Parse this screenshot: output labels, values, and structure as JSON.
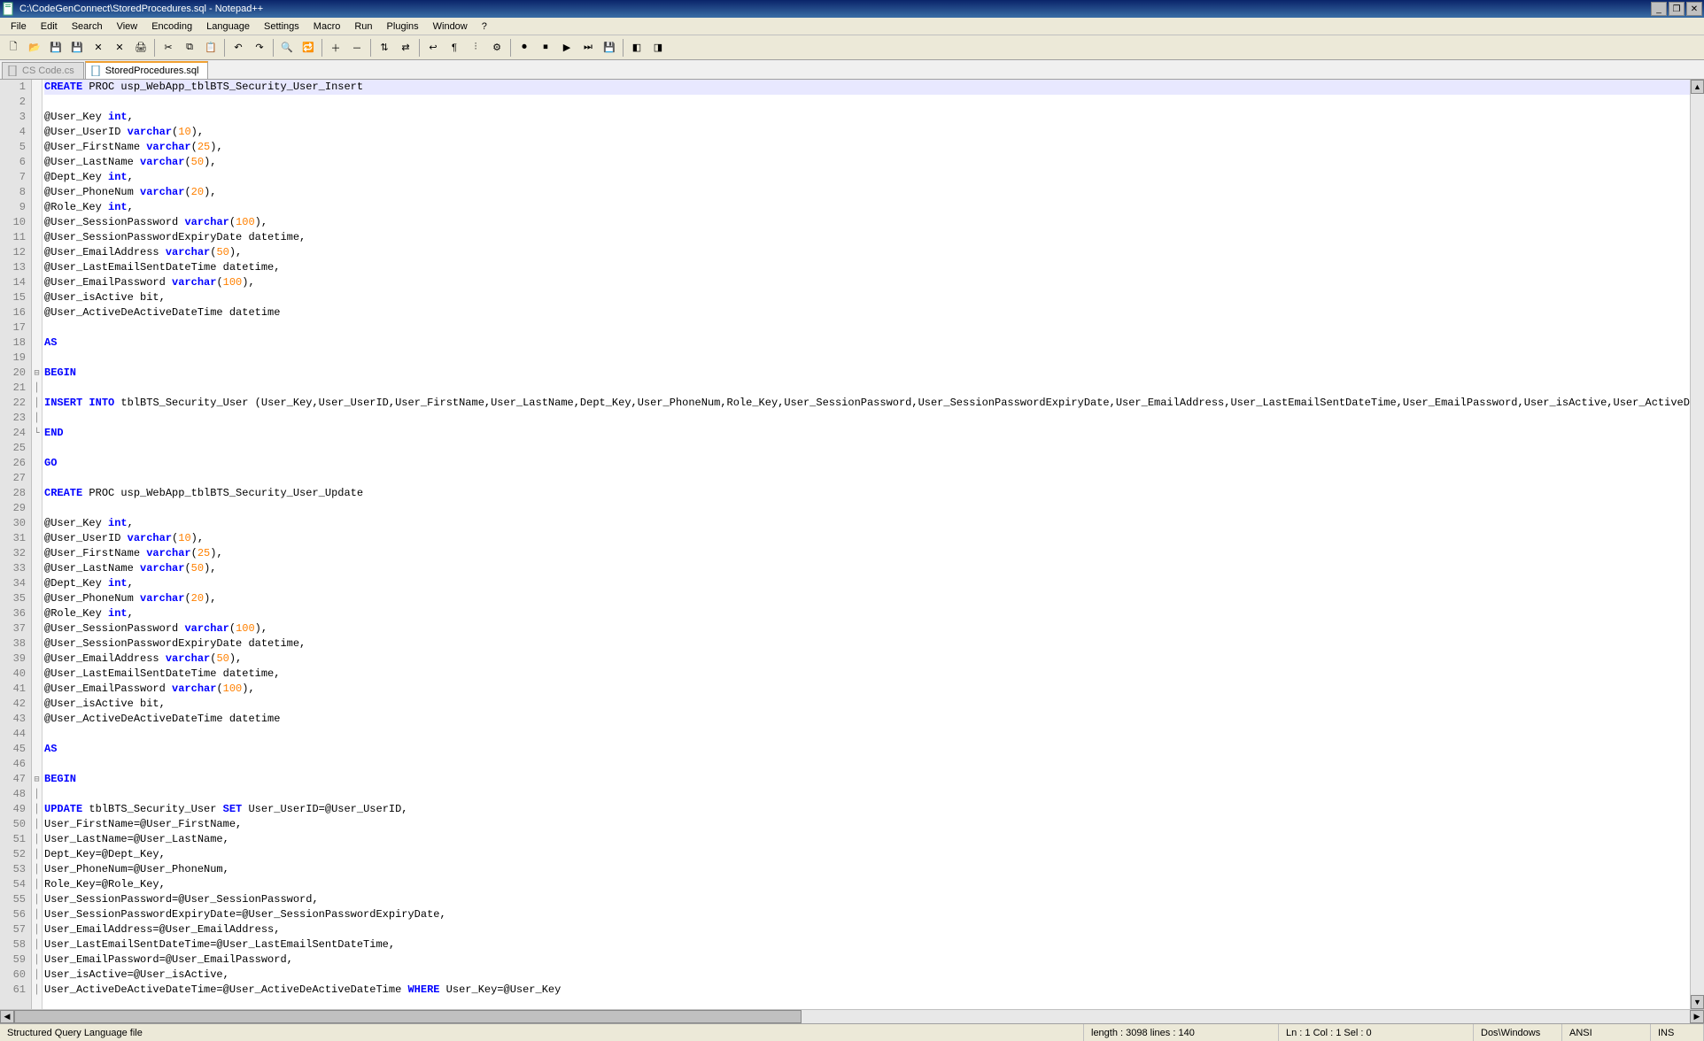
{
  "window": {
    "title": "C:\\CodeGenConnect\\StoredProcedures.sql - Notepad++"
  },
  "menu": {
    "file": "File",
    "edit": "Edit",
    "search": "Search",
    "view": "View",
    "encoding": "Encoding",
    "language": "Language",
    "settings": "Settings",
    "macro": "Macro",
    "run": "Run",
    "plugins": "Plugins",
    "window": "Window",
    "help": "?"
  },
  "tabs": {
    "inactive": "CS Code.cs",
    "active": "StoredProcedures.sql"
  },
  "status": {
    "filetype": "Structured Query Language file",
    "length": "length : 3098    lines : 140",
    "pos": "Ln : 1    Col : 1    Sel : 0",
    "eol": "Dos\\Windows",
    "enc": "ANSI",
    "ins": "INS"
  },
  "code": {
    "lines": [
      {
        "n": 1,
        "fold": "",
        "html": "<span class='kw'>CREATE</span> PROC usp_WebApp_tblBTS_Security_User_Insert",
        "current": true
      },
      {
        "n": 2,
        "fold": "",
        "html": ""
      },
      {
        "n": 3,
        "fold": "",
        "html": "@User_Key <span class='ty'>int</span>,"
      },
      {
        "n": 4,
        "fold": "",
        "html": "@User_UserID <span class='ty'>varchar</span>(<span class='num'>10</span>),"
      },
      {
        "n": 5,
        "fold": "",
        "html": "@User_FirstName <span class='ty'>varchar</span>(<span class='num'>25</span>),"
      },
      {
        "n": 6,
        "fold": "",
        "html": "@User_LastName <span class='ty'>varchar</span>(<span class='num'>50</span>),"
      },
      {
        "n": 7,
        "fold": "",
        "html": "@Dept_Key <span class='ty'>int</span>,"
      },
      {
        "n": 8,
        "fold": "",
        "html": "@User_PhoneNum <span class='ty'>varchar</span>(<span class='num'>20</span>),"
      },
      {
        "n": 9,
        "fold": "",
        "html": "@Role_Key <span class='ty'>int</span>,"
      },
      {
        "n": 10,
        "fold": "",
        "html": "@User_SessionPassword <span class='ty'>varchar</span>(<span class='num'>100</span>),"
      },
      {
        "n": 11,
        "fold": "",
        "html": "@User_SessionPasswordExpiryDate datetime,"
      },
      {
        "n": 12,
        "fold": "",
        "html": "@User_EmailAddress <span class='ty'>varchar</span>(<span class='num'>50</span>),"
      },
      {
        "n": 13,
        "fold": "",
        "html": "@User_LastEmailSentDateTime datetime,"
      },
      {
        "n": 14,
        "fold": "",
        "html": "@User_EmailPassword <span class='ty'>varchar</span>(<span class='num'>100</span>),"
      },
      {
        "n": 15,
        "fold": "",
        "html": "@User_isActive bit,"
      },
      {
        "n": 16,
        "fold": "",
        "html": "@User_ActiveDeActiveDateTime datetime"
      },
      {
        "n": 17,
        "fold": "",
        "html": ""
      },
      {
        "n": 18,
        "fold": "",
        "html": "<span class='kw'>AS</span>"
      },
      {
        "n": 19,
        "fold": "",
        "html": ""
      },
      {
        "n": 20,
        "fold": "⊟",
        "html": "<span class='kw'>BEGIN</span>"
      },
      {
        "n": 21,
        "fold": "│",
        "html": ""
      },
      {
        "n": 22,
        "fold": "│",
        "html": "<span class='kw'>INSERT</span> <span class='kw'>INTO</span> tblBTS_Security_User (User_Key,User_UserID,User_FirstName,User_LastName,Dept_Key,User_PhoneNum,Role_Key,User_SessionPassword,User_SessionPasswordExpiryDate,User_EmailAddress,User_LastEmailSentDateTime,User_EmailPassword,User_isActive,User_ActiveDeAct"
      },
      {
        "n": 23,
        "fold": "│",
        "html": ""
      },
      {
        "n": 24,
        "fold": "└",
        "html": "<span class='kw'>END</span>"
      },
      {
        "n": 25,
        "fold": "",
        "html": ""
      },
      {
        "n": 26,
        "fold": "",
        "html": "<span class='kw'>GO</span>"
      },
      {
        "n": 27,
        "fold": "",
        "html": ""
      },
      {
        "n": 28,
        "fold": "",
        "html": "<span class='kw'>CREATE</span> PROC usp_WebApp_tblBTS_Security_User_Update"
      },
      {
        "n": 29,
        "fold": "",
        "html": ""
      },
      {
        "n": 30,
        "fold": "",
        "html": "@User_Key <span class='ty'>int</span>,"
      },
      {
        "n": 31,
        "fold": "",
        "html": "@User_UserID <span class='ty'>varchar</span>(<span class='num'>10</span>),"
      },
      {
        "n": 32,
        "fold": "",
        "html": "@User_FirstName <span class='ty'>varchar</span>(<span class='num'>25</span>),"
      },
      {
        "n": 33,
        "fold": "",
        "html": "@User_LastName <span class='ty'>varchar</span>(<span class='num'>50</span>),"
      },
      {
        "n": 34,
        "fold": "",
        "html": "@Dept_Key <span class='ty'>int</span>,"
      },
      {
        "n": 35,
        "fold": "",
        "html": "@User_PhoneNum <span class='ty'>varchar</span>(<span class='num'>20</span>),"
      },
      {
        "n": 36,
        "fold": "",
        "html": "@Role_Key <span class='ty'>int</span>,"
      },
      {
        "n": 37,
        "fold": "",
        "html": "@User_SessionPassword <span class='ty'>varchar</span>(<span class='num'>100</span>),"
      },
      {
        "n": 38,
        "fold": "",
        "html": "@User_SessionPasswordExpiryDate datetime,"
      },
      {
        "n": 39,
        "fold": "",
        "html": "@User_EmailAddress <span class='ty'>varchar</span>(<span class='num'>50</span>),"
      },
      {
        "n": 40,
        "fold": "",
        "html": "@User_LastEmailSentDateTime datetime,"
      },
      {
        "n": 41,
        "fold": "",
        "html": "@User_EmailPassword <span class='ty'>varchar</span>(<span class='num'>100</span>),"
      },
      {
        "n": 42,
        "fold": "",
        "html": "@User_isActive bit,"
      },
      {
        "n": 43,
        "fold": "",
        "html": "@User_ActiveDeActiveDateTime datetime"
      },
      {
        "n": 44,
        "fold": "",
        "html": ""
      },
      {
        "n": 45,
        "fold": "",
        "html": "<span class='kw'>AS</span>"
      },
      {
        "n": 46,
        "fold": "",
        "html": ""
      },
      {
        "n": 47,
        "fold": "⊟",
        "html": "<span class='kw'>BEGIN</span>"
      },
      {
        "n": 48,
        "fold": "│",
        "html": ""
      },
      {
        "n": 49,
        "fold": "│",
        "html": "<span class='kw'>UPDATE</span> tblBTS_Security_User <span class='kw'>SET</span> User_UserID=@User_UserID,"
      },
      {
        "n": 50,
        "fold": "│",
        "html": "User_FirstName=@User_FirstName,"
      },
      {
        "n": 51,
        "fold": "│",
        "html": "User_LastName=@User_LastName,"
      },
      {
        "n": 52,
        "fold": "│",
        "html": "Dept_Key=@Dept_Key,"
      },
      {
        "n": 53,
        "fold": "│",
        "html": "User_PhoneNum=@User_PhoneNum,"
      },
      {
        "n": 54,
        "fold": "│",
        "html": "Role_Key=@Role_Key,"
      },
      {
        "n": 55,
        "fold": "│",
        "html": "User_SessionPassword=@User_SessionPassword,"
      },
      {
        "n": 56,
        "fold": "│",
        "html": "User_SessionPasswordExpiryDate=@User_SessionPasswordExpiryDate,"
      },
      {
        "n": 57,
        "fold": "│",
        "html": "User_EmailAddress=@User_EmailAddress,"
      },
      {
        "n": 58,
        "fold": "│",
        "html": "User_LastEmailSentDateTime=@User_LastEmailSentDateTime,"
      },
      {
        "n": 59,
        "fold": "│",
        "html": "User_EmailPassword=@User_EmailPassword,"
      },
      {
        "n": 60,
        "fold": "│",
        "html": "User_isActive=@User_isActive,"
      },
      {
        "n": 61,
        "fold": "│",
        "html": "User_ActiveDeActiveDateTime=@User_ActiveDeActiveDateTime <span class='kw'>WHERE</span> User_Key=@User_Key"
      }
    ]
  },
  "toolbar_icons": [
    {
      "name": "new-file-icon",
      "glyph": "🗋"
    },
    {
      "name": "open-file-icon",
      "glyph": "📂"
    },
    {
      "name": "save-icon",
      "glyph": "💾"
    },
    {
      "name": "save-all-icon",
      "glyph": "💾"
    },
    {
      "name": "close-file-icon",
      "glyph": "✕"
    },
    {
      "name": "close-all-icon",
      "glyph": "✕"
    },
    {
      "name": "print-icon",
      "glyph": "🖨"
    },
    {
      "sep": true
    },
    {
      "name": "cut-icon",
      "glyph": "✂"
    },
    {
      "name": "copy-icon",
      "glyph": "⧉"
    },
    {
      "name": "paste-icon",
      "glyph": "📋"
    },
    {
      "sep": true
    },
    {
      "name": "undo-icon",
      "glyph": "↶"
    },
    {
      "name": "redo-icon",
      "glyph": "↷"
    },
    {
      "sep": true
    },
    {
      "name": "find-icon",
      "glyph": "🔍"
    },
    {
      "name": "replace-icon",
      "glyph": "🔁"
    },
    {
      "sep": true
    },
    {
      "name": "zoom-in-icon",
      "glyph": "＋"
    },
    {
      "name": "zoom-out-icon",
      "glyph": "－"
    },
    {
      "sep": true
    },
    {
      "name": "sync-vscroll-icon",
      "glyph": "⇅"
    },
    {
      "name": "sync-hscroll-icon",
      "glyph": "⇄"
    },
    {
      "sep": true
    },
    {
      "name": "wordwrap-icon",
      "glyph": "↩"
    },
    {
      "name": "show-all-chars-icon",
      "glyph": "¶"
    },
    {
      "name": "indent-guide-icon",
      "glyph": "⫶"
    },
    {
      "name": "user-lang-icon",
      "glyph": "⚙"
    },
    {
      "sep": true
    },
    {
      "name": "record-macro-icon",
      "glyph": "⏺"
    },
    {
      "name": "stop-macro-icon",
      "glyph": "⏹"
    },
    {
      "name": "play-macro-icon",
      "glyph": "▶"
    },
    {
      "name": "play-multi-icon",
      "glyph": "⏭"
    },
    {
      "name": "save-macro-icon",
      "glyph": "💾"
    },
    {
      "sep": true
    },
    {
      "name": "plugin1-icon",
      "glyph": "◧"
    },
    {
      "name": "plugin2-icon",
      "glyph": "◨"
    }
  ]
}
